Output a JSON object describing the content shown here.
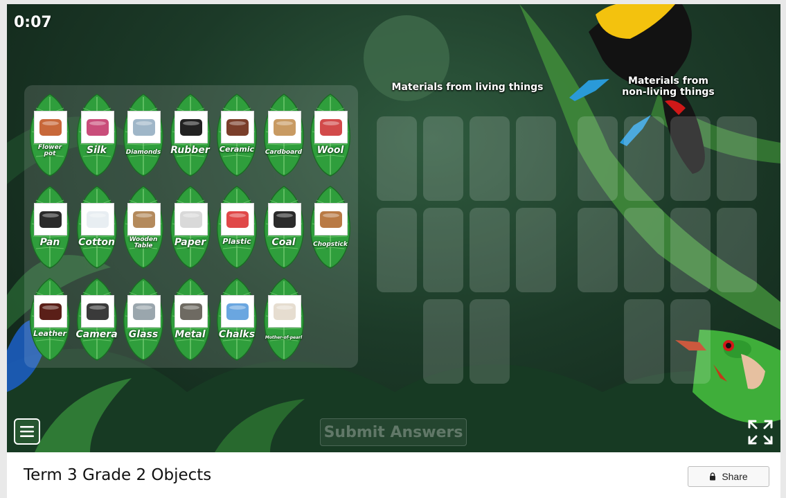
{
  "timer": "0:07",
  "categories": {
    "living": "Materials from living things",
    "nonliving_line1": "Materials from",
    "nonliving_line2": "non-living things"
  },
  "items": [
    {
      "label": "Flower pot",
      "line1": "Flower",
      "line2": "pot",
      "icon": "flower-pot-icon",
      "color": "#c8683a"
    },
    {
      "label": "Silk",
      "icon": "silk-icon",
      "color": "#c94d7a"
    },
    {
      "label": "Diamonds",
      "icon": "diamond-icon",
      "color": "#9fb6c8"
    },
    {
      "label": "Rubber",
      "icon": "tyre-icon",
      "color": "#222222"
    },
    {
      "label": "Ceramic",
      "icon": "ceramic-pot-icon",
      "color": "#7a3e2a"
    },
    {
      "label": "Cardboard",
      "icon": "cardboard-box-icon",
      "color": "#c89a62"
    },
    {
      "label": "Wool",
      "icon": "wool-balls-icon",
      "color": "#d24a4a"
    },
    {
      "label": "Pan",
      "icon": "pan-icon",
      "color": "#2a2a2a"
    },
    {
      "label": "Cotton",
      "icon": "cotton-balls-icon",
      "color": "#e8eef2"
    },
    {
      "label": "Wooden Table",
      "line1": "Wooden",
      "line2": "Table",
      "icon": "wooden-table-icon",
      "color": "#b48a5c"
    },
    {
      "label": "Paper",
      "icon": "paper-icon",
      "color": "#d9d9d9"
    },
    {
      "label": "Plastic",
      "icon": "plastic-toys-icon",
      "color": "#e04848"
    },
    {
      "label": "Coal",
      "icon": "coal-icon",
      "color": "#2b2b2b"
    },
    {
      "label": "Chopstick",
      "icon": "chopstick-icon",
      "color": "#b97a45"
    },
    {
      "label": "Leather",
      "icon": "leather-shoes-icon",
      "color": "#5a1f18"
    },
    {
      "label": "Camera",
      "icon": "camera-icon",
      "color": "#3a3a3a"
    },
    {
      "label": "Glass",
      "icon": "wine-glass-icon",
      "color": "#9aa6ad"
    },
    {
      "label": "Metal",
      "icon": "scrap-metal-icon",
      "color": "#6e6a62"
    },
    {
      "label": "Chalks",
      "icon": "chalks-icon",
      "color": "#6aa6e0"
    },
    {
      "label": "Mother-of-pearl",
      "icon": "pearl-icon",
      "color": "#e6ddd0"
    }
  ],
  "submit_label": "Submit Answers",
  "footer": {
    "title": "Term 3 Grade 2 Objects",
    "share_label": "Share"
  },
  "icons": {
    "menu": "hamburger-menu-icon",
    "fullscreen": "fullscreen-icon",
    "share": "lock-icon"
  }
}
